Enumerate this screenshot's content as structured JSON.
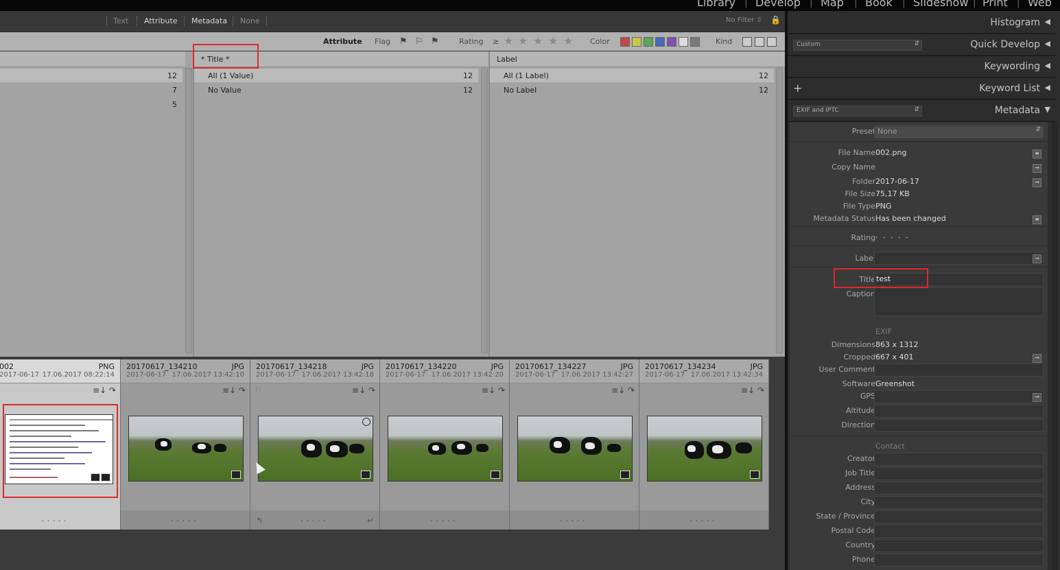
{
  "top_modules": [
    "Library",
    "Develop",
    "Map",
    "Book",
    "Slideshow",
    "Print",
    "Web"
  ],
  "filter_bar": {
    "tabs": [
      "Text",
      "Attribute",
      "Metadata",
      "None"
    ],
    "no_filter": "No Filter ⇳"
  },
  "attribute_bar": {
    "title": "Attribute",
    "flag": "Flag",
    "rating": "Rating",
    "rating_op": "≥",
    "color": "Color",
    "kind": "Kind",
    "swatch_colors": [
      "#c04848",
      "#c8c848",
      "#58a858",
      "#4868b8",
      "#8050b0",
      "#dcdcdc",
      "#7a7a7a"
    ]
  },
  "browser": {
    "col1_counts": [
      "12",
      "7",
      "5"
    ],
    "col2": {
      "header": "* Title *",
      "rows": [
        {
          "label": "All (1 Value)",
          "count": "12"
        },
        {
          "label": "No Value",
          "count": "12"
        }
      ]
    },
    "col3": {
      "header": "Label",
      "rows": [
        {
          "label": "All (1 Label)",
          "count": "12"
        },
        {
          "label": "No Label",
          "count": "12"
        }
      ]
    }
  },
  "filmstrip": [
    {
      "name": "002",
      "type": "PNG",
      "date": "2017-06-17",
      "datetime": "17.06.2017 08:22:14"
    },
    {
      "name": "20170617_134210",
      "type": "JPG",
      "date": "2017-06-17",
      "datetime": "17.06.2017 13:42:10"
    },
    {
      "name": "20170617_134218",
      "type": "JPG",
      "date": "2017-06-17",
      "datetime": "17.06.2017 13:42:18"
    },
    {
      "name": "20170617_134220",
      "type": "JPG",
      "date": "2017-06-17",
      "datetime": "17.06.2017 13:42:20"
    },
    {
      "name": "20170617_134227",
      "type": "JPG",
      "date": "2017-06-17",
      "datetime": "17.06.2017 13:42:27"
    },
    {
      "name": "20170617_134234",
      "type": "JPG",
      "date": "2017-06-17",
      "datetime": "17.06.2017 13:42:34"
    }
  ],
  "right_panel": {
    "histogram": "Histogram",
    "quick_develop": "Quick Develop",
    "quick_develop_preset": "Custom",
    "keywording": "Keywording",
    "keyword_list": "Keyword List",
    "metadata": "Metadata",
    "metadata_preset": "EXIF and IPTC",
    "preset_label": "Preset",
    "preset_value": "None",
    "fields": {
      "file_name": {
        "label": "File Name",
        "value": "002.png"
      },
      "copy_name": {
        "label": "Copy Name",
        "value": ""
      },
      "folder": {
        "label": "Folder",
        "value": "2017-06-17"
      },
      "file_size": {
        "label": "File Size",
        "value": "75,17 KB"
      },
      "file_type": {
        "label": "File Type",
        "value": "PNG"
      },
      "metadata_status": {
        "label": "Metadata Status",
        "value": "Has been changed"
      },
      "rating": {
        "label": "Rating",
        "value": "· · · · ·"
      },
      "label": {
        "label": "Label",
        "value": ""
      },
      "title": {
        "label": "Title",
        "value": "test"
      },
      "caption": {
        "label": "Caption",
        "value": ""
      }
    },
    "exif_section": "EXIF",
    "exif": {
      "dimensions": {
        "label": "Dimensions",
        "value": "863 x 1312"
      },
      "cropped": {
        "label": "Cropped",
        "value": "667 x 401"
      },
      "user_comment": {
        "label": "User Comment",
        "value": ""
      },
      "software": {
        "label": "Software",
        "value": "Greenshot"
      },
      "gps": {
        "label": "GPS",
        "value": ""
      },
      "altitude": {
        "label": "Altitude",
        "value": ""
      },
      "direction": {
        "label": "Direction",
        "value": ""
      }
    },
    "contact_section": "Contact",
    "contact": [
      "Creator",
      "Job Title",
      "Address",
      "City",
      "State / Province",
      "Postal Code",
      "Country",
      "Phone"
    ]
  }
}
